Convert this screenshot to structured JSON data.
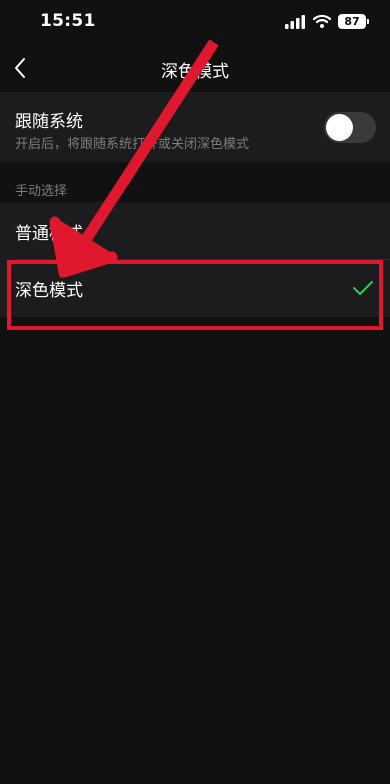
{
  "status_bar": {
    "time": "15:51",
    "battery": "87"
  },
  "nav": {
    "title": "深色模式"
  },
  "follow_system": {
    "title": "跟随系统",
    "description": "开启后，将跟随系统打开或关闭深色模式",
    "enabled": false
  },
  "manual_section": {
    "label": "手动选择",
    "options": [
      {
        "label": "普通模式",
        "selected": false
      },
      {
        "label": "深色模式",
        "selected": true
      }
    ]
  },
  "colors": {
    "background": "#111111",
    "row_background": "#1c1c1e",
    "check_green": "#34c759",
    "annotation_red": "#e0182d"
  }
}
